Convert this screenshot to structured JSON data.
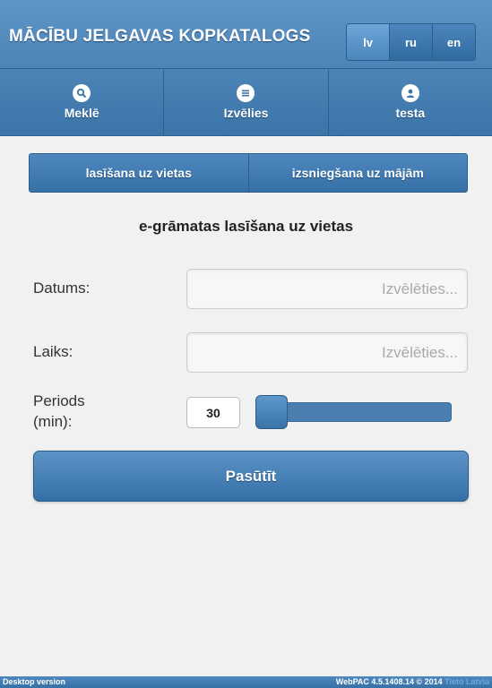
{
  "header": {
    "title": "MĀCĪBU JELGAVAS KOPKATALOGS",
    "languages": [
      {
        "label": "lv",
        "active": true
      },
      {
        "label": "ru",
        "active": false
      },
      {
        "label": "en",
        "active": false
      }
    ],
    "nav": [
      {
        "label": "Meklē",
        "icon": "search-icon"
      },
      {
        "label": "Izvēlies",
        "icon": "list-icon"
      },
      {
        "label": "testa",
        "icon": "user-icon"
      }
    ]
  },
  "segment": {
    "options": [
      "lasīšana uz vietas",
      "izsniegšana uz mājām"
    ]
  },
  "form": {
    "heading": "e-grāmatas lasīšana uz vietas",
    "date_label": "Datums:",
    "date_placeholder": "Izvēlēties...",
    "time_label": "Laiks:",
    "time_placeholder": "Izvēlēties...",
    "period_label_line1": "Periods",
    "period_label_line2": "(min):",
    "period_value": "30",
    "slider_fraction": 0.0,
    "submit_label": "Pasūtīt"
  },
  "footer": {
    "left": "Desktop version",
    "right": "WebPAC 4.5.1408.14 © 2014",
    "brand": "Tieto Latvia"
  },
  "colors": {
    "accent": "#3b74a8",
    "accent_light": "#5e95c7",
    "background": "#f1f1f1"
  }
}
